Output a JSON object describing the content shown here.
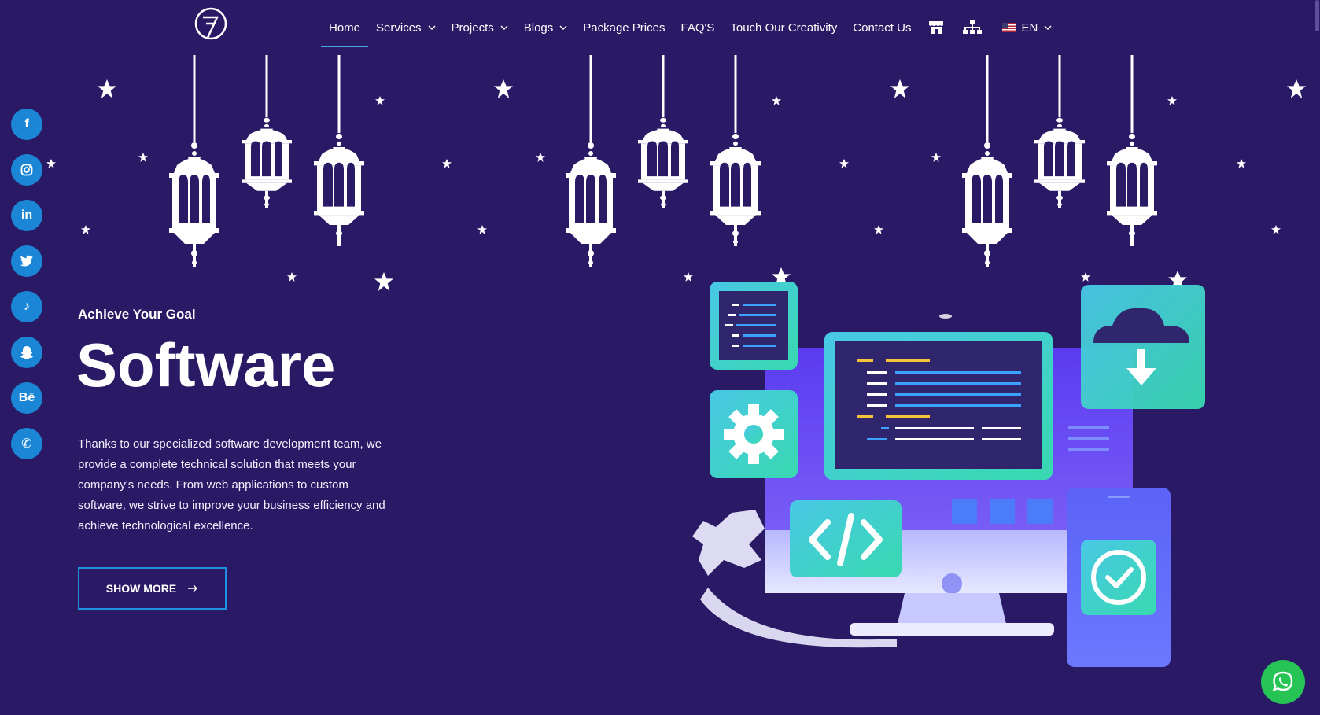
{
  "brand": {
    "logo_icon": "brand-logo-icon",
    "colors": {
      "background": "#2a1a66",
      "accent": "#1f8fe0",
      "social": "#1c86d6",
      "whatsapp": "#25c455"
    }
  },
  "nav": {
    "items": [
      {
        "label": "Home",
        "active": true,
        "dropdown": false
      },
      {
        "label": "Services",
        "dropdown": true
      },
      {
        "label": "Projects",
        "dropdown": true
      },
      {
        "label": "Blogs",
        "dropdown": true
      },
      {
        "label": "Package Prices",
        "dropdown": false
      },
      {
        "label": "FAQ'S",
        "dropdown": false
      },
      {
        "label": "Touch Our Creativity",
        "dropdown": false
      },
      {
        "label": "Contact Us",
        "dropdown": false
      }
    ],
    "icons": [
      "store-icon",
      "sitemap-icon"
    ],
    "language": {
      "label": "EN",
      "flag": "us-flag-icon"
    }
  },
  "social": [
    {
      "name": "facebook-icon",
      "glyph": "f"
    },
    {
      "name": "instagram-icon",
      "glyph": ""
    },
    {
      "name": "linkedin-icon",
      "glyph": "in"
    },
    {
      "name": "twitter-icon",
      "glyph": ""
    },
    {
      "name": "tiktok-icon",
      "glyph": "♪"
    },
    {
      "name": "snapchat-icon",
      "glyph": ""
    },
    {
      "name": "behance-icon",
      "glyph": "Bē"
    },
    {
      "name": "phone-icon",
      "glyph": "✆"
    }
  ],
  "hero": {
    "kicker": "Achieve Your Goal",
    "headline": "Software",
    "description": "Thanks to our specialized software development team, we provide a complete technical solution that meets your company's needs. From web applications to custom software, we strive to improve your business efficiency and achieve technological excellence.",
    "cta_label": "SHOW MORE",
    "cta_icon": "arrow-right-icon"
  },
  "decorations": {
    "lanterns": "ramadan-lanterns-illustration",
    "illustration": "software-development-illustration"
  },
  "whatsapp": {
    "icon": "whatsapp-icon"
  }
}
